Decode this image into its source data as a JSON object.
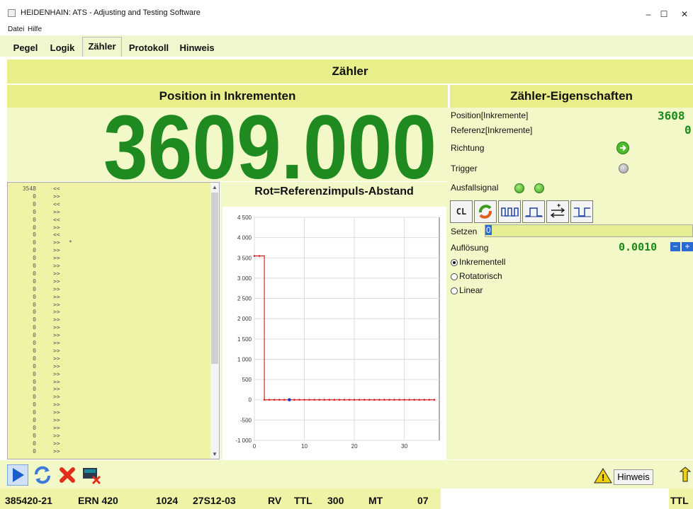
{
  "window": {
    "title": "HEIDENHAIN: ATS - Adjusting and Testing Software",
    "controls": [
      "–",
      "☐",
      "✕"
    ]
  },
  "menu": [
    "Datei",
    "Hilfe"
  ],
  "tabs": [
    "Pegel",
    "Logik",
    "Zähler",
    "Protokoll",
    "Hinweis"
  ],
  "active_tab": "Zähler",
  "header": "Zähler",
  "position_panel": {
    "title": "Position in Inkrementen",
    "value": "3609.000"
  },
  "properties": {
    "title": "Zähler-Eigenschaften",
    "position_label": "Position[Inkremente]",
    "position_value": "3608",
    "reference_label": "Referenz[Inkremente]",
    "reference_value": "0",
    "direction_label": "Richtung",
    "trigger_label": "Trigger",
    "failure_label": "Ausfallsignal",
    "tools": [
      "CL",
      "reload-icon",
      "pulse-train-icon",
      "single-pulse-icon",
      "direction-toggle-icon",
      "inverted-pulse-icon"
    ],
    "setzen_label": "Setzen",
    "setzen_value": "0",
    "resolution_label": "Auflösung",
    "resolution_value": "0.0010",
    "modes": [
      "Inkrementell",
      "Rotatorisch",
      "Linear"
    ],
    "selected_mode": "Inkrementell"
  },
  "list": {
    "rows": [
      {
        "n": "3548",
        "a": "<<",
        "s": ""
      },
      {
        "n": "0",
        "a": ">>",
        "s": ""
      },
      {
        "n": "0",
        "a": "<<",
        "s": ""
      },
      {
        "n": "0",
        "a": ">>",
        "s": ""
      },
      {
        "n": "0",
        "a": "<<",
        "s": ""
      },
      {
        "n": "0",
        "a": ">>",
        "s": ""
      },
      {
        "n": "0",
        "a": "<<",
        "s": ""
      },
      {
        "n": "0",
        "a": ">>",
        "s": "*"
      },
      {
        "n": "0",
        "a": ">>",
        "s": ""
      },
      {
        "n": "0",
        "a": ">>",
        "s": ""
      },
      {
        "n": "0",
        "a": ">>",
        "s": ""
      },
      {
        "n": "0",
        "a": ">>",
        "s": ""
      },
      {
        "n": "0",
        "a": ">>",
        "s": ""
      },
      {
        "n": "0",
        "a": ">>",
        "s": ""
      },
      {
        "n": "0",
        "a": ">>",
        "s": ""
      },
      {
        "n": "0",
        "a": ">>",
        "s": ""
      },
      {
        "n": "0",
        "a": ">>",
        "s": ""
      },
      {
        "n": "0",
        "a": ">>",
        "s": ""
      },
      {
        "n": "0",
        "a": ">>",
        "s": ""
      },
      {
        "n": "0",
        "a": ">>",
        "s": ""
      },
      {
        "n": "0",
        "a": ">>",
        "s": ""
      },
      {
        "n": "0",
        "a": ">>",
        "s": ""
      },
      {
        "n": "0",
        "a": ">>",
        "s": ""
      },
      {
        "n": "0",
        "a": ">>",
        "s": ""
      },
      {
        "n": "0",
        "a": ">>",
        "s": ""
      },
      {
        "n": "0",
        "a": ">>",
        "s": ""
      },
      {
        "n": "0",
        "a": ">>",
        "s": ""
      },
      {
        "n": "0",
        "a": ">>",
        "s": ""
      },
      {
        "n": "0",
        "a": ">>",
        "s": ""
      },
      {
        "n": "0",
        "a": ">>",
        "s": ""
      },
      {
        "n": "0",
        "a": ">>",
        "s": ""
      },
      {
        "n": "0",
        "a": ">>",
        "s": ""
      },
      {
        "n": "0",
        "a": ">>",
        "s": ""
      },
      {
        "n": "0",
        "a": ">>",
        "s": ""
      },
      {
        "n": "0",
        "a": ">>",
        "s": ""
      }
    ]
  },
  "chart_data": {
    "type": "line",
    "title": "Rot=Referenzimpuls-Abstand",
    "ylim": [
      -1000,
      4500
    ],
    "xlim": [
      0,
      37
    ],
    "yticks": [
      "4 500",
      "4 000",
      "3 500",
      "3 000",
      "2 500",
      "2 000",
      "1 500",
      "1 000",
      "500",
      "0",
      "-500",
      "-1 000"
    ],
    "xticks": [
      "0",
      "10",
      "20",
      "30"
    ],
    "grid": true,
    "series": [
      {
        "color": "#e02020",
        "x": [
          0,
          1,
          2,
          3,
          4,
          5,
          6,
          7,
          8,
          9,
          10,
          11,
          12,
          13,
          14,
          15,
          16,
          17,
          18,
          19,
          20,
          21,
          22,
          23,
          24,
          25,
          26,
          27,
          28,
          29,
          30,
          31,
          32,
          33,
          34,
          35,
          36
        ],
        "y": [
          3548,
          3548,
          0,
          0,
          0,
          0,
          0,
          0,
          0,
          0,
          0,
          0,
          0,
          0,
          0,
          0,
          0,
          0,
          0,
          0,
          0,
          0,
          0,
          0,
          0,
          0,
          0,
          0,
          0,
          0,
          0,
          0,
          0,
          0,
          0,
          0,
          0
        ]
      }
    ],
    "marker": {
      "x": 7,
      "y": 0,
      "color": "#1030c0"
    }
  },
  "toolbar": {
    "hinweis_label": "Hinweis"
  },
  "status": {
    "id": "385420-21",
    "model": "ERN 420",
    "lines": "1024",
    "code": "27S12-03",
    "rv": "RV",
    "ttl": "TTL",
    "num": "300",
    "mt": "MT",
    "mtnum": "07",
    "ttl_right": "TTL"
  },
  "colors": {
    "panel": "#f2f8c8",
    "header": "#e8ef8a",
    "segment": "#1f8a1f"
  }
}
